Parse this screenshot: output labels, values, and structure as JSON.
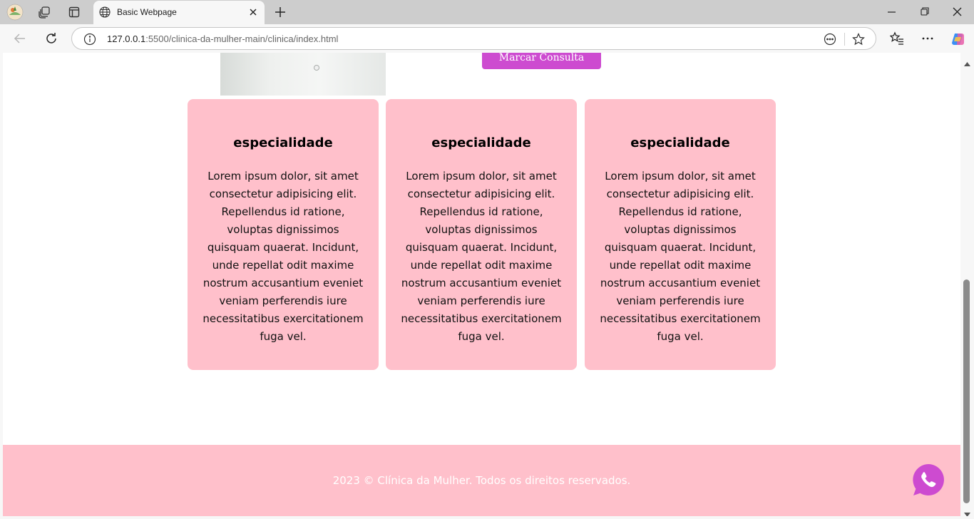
{
  "browser": {
    "tab_title": "Basic Webpage",
    "url_host": "127.0.0.1",
    "url_path": ":5500/clinica-da-mulher-main/clinica/index.html",
    "icons": [
      "profile-avatar-icon",
      "workspaces-icon",
      "tab-actions-icon",
      "globe-icon",
      "close-icon",
      "plus-icon",
      "minimize-icon",
      "restore-icon",
      "window-close-icon",
      "back-arrow-icon",
      "reload-icon",
      "info-icon",
      "read-aloud-icon",
      "favorite-star-icon",
      "favorites-list-icon",
      "more-icon",
      "copilot-icon"
    ]
  },
  "page": {
    "cta_label": "Marcar Consulta",
    "cards": [
      {
        "title": "especialidade",
        "text": "Lorem ipsum dolor, sit amet consectetur adipisicing elit. Repellendus id ratione, voluptas dignissimos quisquam quaerat. Incidunt, unde repellat odit maxime nostrum accusantium eveniet veniam perferendis iure necessitatibus exercitationem fuga vel."
      },
      {
        "title": "especialidade",
        "text": "Lorem ipsum dolor, sit amet consectetur adipisicing elit. Repellendus id ratione, voluptas dignissimos quisquam quaerat. Incidunt, unde repellat odit maxime nostrum accusantium eveniet veniam perferendis iure necessitatibus exercitationem fuga vel."
      },
      {
        "title": "especialidade",
        "text": "Lorem ipsum dolor, sit amet consectetur adipisicing elit. Repellendus id ratione, voluptas dignissimos quisquam quaerat. Incidunt, unde repellat odit maxime nostrum accusantium eveniet veniam perferendis iure necessitatibus exercitationem fuga vel."
      }
    ],
    "footer_text": "2023 © Clínica da Mulher. Todos os direitos reservados.",
    "colors": {
      "card_bg": "#ffc0cb",
      "cta_bg": "#cd4bd0",
      "whatsapp": "#cd4bd0",
      "footer_bg": "#ffc0cb"
    }
  }
}
